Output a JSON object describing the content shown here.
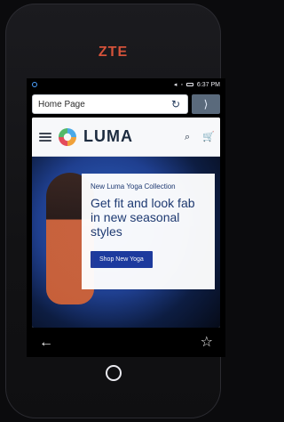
{
  "device": {
    "brand": "ZTE"
  },
  "status_bar": {
    "time": "6:37 PM"
  },
  "browser": {
    "url_text": "Home Page",
    "reload_icon": "reload-icon",
    "tabs_icon": "tabs-icon"
  },
  "site": {
    "wordmark": "LUMA",
    "icons": {
      "menu": "hamburger-menu-icon",
      "search": "search-icon",
      "cart": "cart-icon"
    }
  },
  "hero": {
    "kicker": "New Luma Yoga Collection",
    "title": "Get fit and look fab in new seasonal styles",
    "cta": "Shop New Yoga"
  },
  "nav": {
    "back_icon": "back-arrow-icon",
    "favorite_icon": "star-icon"
  }
}
